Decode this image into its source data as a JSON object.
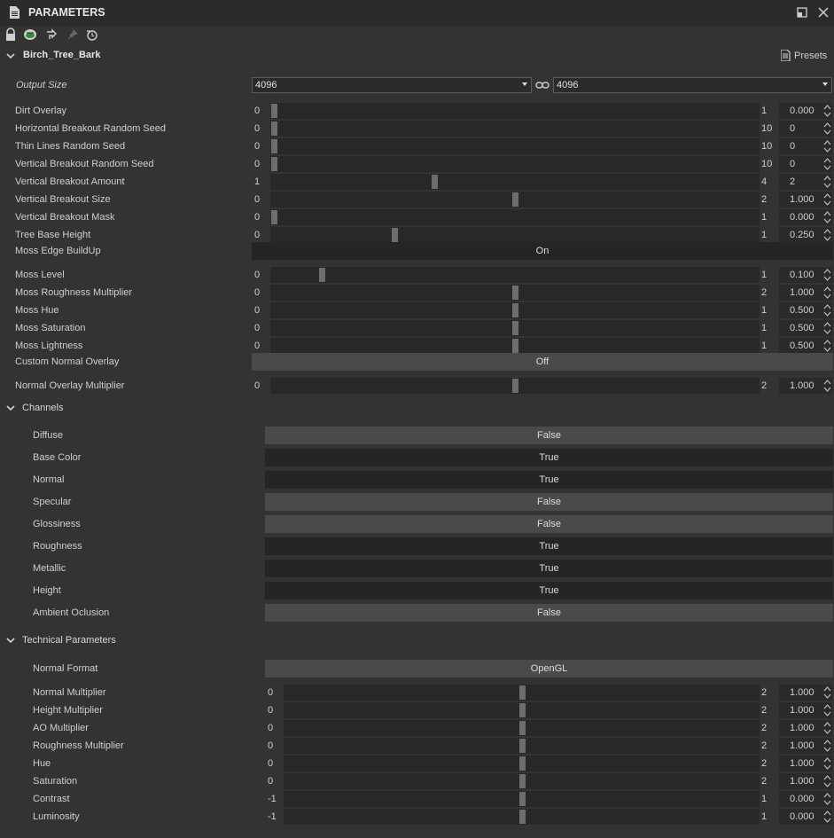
{
  "panel": {
    "title": "PARAMETERS"
  },
  "preset": {
    "name": "Birch_Tree_Bark",
    "presets_label": "Presets"
  },
  "output_size": {
    "label": "Output Size",
    "width": "4096",
    "height": "4096"
  },
  "params": [
    {
      "label": "Dirt Overlay",
      "min": "0",
      "max": "1",
      "value": "0.000",
      "level": 0.0
    },
    {
      "label": "Horizontal Breakout Random Seed",
      "min": "0",
      "max": "10",
      "value": "0",
      "level": 0.0
    },
    {
      "label": "Thin Lines Random Seed",
      "min": "0",
      "max": "10",
      "value": "0",
      "level": 0.0
    },
    {
      "label": "Vertical Breakout Random Seed",
      "min": "0",
      "max": "10",
      "value": "0",
      "level": 0.0
    },
    {
      "label": "Vertical Breakout Amount",
      "min": "1",
      "max": "4",
      "value": "2",
      "level": 0.333
    },
    {
      "label": "Vertical Breakout Size",
      "min": "0",
      "max": "2",
      "value": "1.000",
      "level": 0.5
    },
    {
      "label": "Vertical Breakout Mask",
      "min": "0",
      "max": "1",
      "value": "0.000",
      "level": 0.0
    },
    {
      "label": "Tree Base Height",
      "min": "0",
      "max": "1",
      "value": "0.250",
      "level": 0.25
    }
  ],
  "moss_edge": {
    "label": "Moss Edge BuildUp",
    "value": "On"
  },
  "moss_params": [
    {
      "label": "Moss Level",
      "min": "0",
      "max": "1",
      "value": "0.100",
      "level": 0.1
    },
    {
      "label": "Moss Roughness Multiplier",
      "min": "0",
      "max": "2",
      "value": "1.000",
      "level": 0.5
    },
    {
      "label": "Moss Hue",
      "min": "0",
      "max": "1",
      "value": "0.500",
      "level": 0.5
    },
    {
      "label": "Moss Saturation",
      "min": "0",
      "max": "1",
      "value": "0.500",
      "level": 0.5
    },
    {
      "label": "Moss Lightness",
      "min": "0",
      "max": "1",
      "value": "0.500",
      "level": 0.5
    }
  ],
  "custom_normal": {
    "label": "Custom Normal Overlay",
    "value": "Off"
  },
  "normal_overlay": {
    "label": "Normal Overlay Multiplier",
    "min": "0",
    "max": "2",
    "value": "1.000",
    "level": 0.5
  },
  "channels": {
    "title": "Channels",
    "items": [
      {
        "label": "Diffuse",
        "value": "False"
      },
      {
        "label": "Base Color",
        "value": "True"
      },
      {
        "label": "Normal",
        "value": "True"
      },
      {
        "label": "Specular",
        "value": "False"
      },
      {
        "label": "Glossiness",
        "value": "False"
      },
      {
        "label": "Roughness",
        "value": "True"
      },
      {
        "label": "Metallic",
        "value": "True"
      },
      {
        "label": "Height",
        "value": "True"
      },
      {
        "label": "Ambient Oclusion",
        "value": "False"
      }
    ]
  },
  "technical": {
    "title": "Technical Parameters",
    "normal_format": {
      "label": "Normal Format",
      "value": "OpenGL"
    },
    "params": [
      {
        "label": "Normal Multiplier",
        "min": "0",
        "max": "2",
        "value": "1.000",
        "level": 0.5
      },
      {
        "label": "Height Multiplier",
        "min": "0",
        "max": "2",
        "value": "1.000",
        "level": 0.5
      },
      {
        "label": "AO Multiplier",
        "min": "0",
        "max": "2",
        "value": "1.000",
        "level": 0.5
      },
      {
        "label": "Roughness Multiplier",
        "min": "0",
        "max": "2",
        "value": "1.000",
        "level": 0.5
      },
      {
        "label": "Hue",
        "min": "0",
        "max": "2",
        "value": "1.000",
        "level": 0.5
      },
      {
        "label": "Saturation",
        "min": "0",
        "max": "2",
        "value": "1.000",
        "level": 0.5
      },
      {
        "label": "Contrast",
        "min": "-1",
        "max": "1",
        "value": "0.000",
        "level": 0.5
      },
      {
        "label": "Luminosity",
        "min": "-1",
        "max": "1",
        "value": "0.000",
        "level": 0.5
      }
    ]
  },
  "colors": {
    "bg": "#333333",
    "track": "#282828",
    "handle": "#6d6d6d",
    "true_btn": "#252525",
    "false_btn": "#4a4a4a"
  },
  "icons": [
    "document-icon",
    "maximize-icon",
    "close-icon",
    "lock-icon",
    "sync-icon",
    "link-out-icon",
    "pin-icon",
    "reset-icon",
    "chevron-down-icon",
    "chain-link-icon",
    "spinner-icon"
  ]
}
